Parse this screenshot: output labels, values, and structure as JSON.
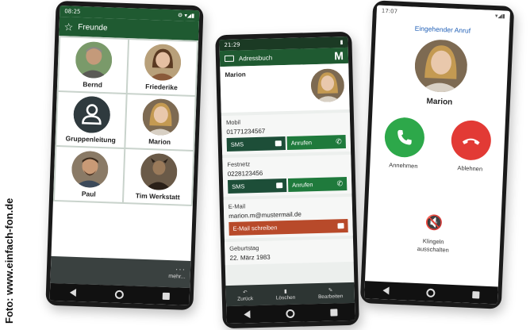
{
  "credit": "Foto: www.einfach-fon.de",
  "phone1": {
    "status_time": "08:25",
    "status_icons": "⚙ ▾◢▮",
    "header_title": "Freunde",
    "contacts": [
      {
        "name": "Bernd",
        "skin": "#c49a7a",
        "bg": "#7a9a6a",
        "hair": "#8a8a85"
      },
      {
        "name": "Friederike",
        "skin": "#e4bfa2",
        "bg": "#b8a07a",
        "hair": "#5a3a22"
      },
      {
        "name": "Gruppenleitung",
        "skin": "",
        "bg": "#2f3a3e",
        "hair": ""
      },
      {
        "name": "Marion",
        "skin": "#e9c8ac",
        "bg": "#7d6a52",
        "hair": "#c49a52"
      },
      {
        "name": "Paul",
        "skin": "#c99a76",
        "bg": "#8a7a66",
        "hair": "#3a2a1c"
      },
      {
        "name": "Tim Werkstatt",
        "skin": "#9a7a5a",
        "bg": "#6a5a48",
        "hair": "#2a2018"
      }
    ],
    "more_label": "mehr..."
  },
  "phone2": {
    "status_time": "21:29",
    "header_title": "Adressbuch",
    "header_letter": "M",
    "contact_name": "Marion",
    "mobile_label": "Mobil",
    "mobile_value": "01771234567",
    "landline_label": "Festnetz",
    "landline_value": "0228123456",
    "sms_label": "SMS",
    "call_label": "Anrufen",
    "email_label": "E-Mail",
    "email_value": "marion.m@mustermail.de",
    "email_button": "E-Mail schreiben",
    "birthday_label": "Geburtstag",
    "birthday_value": "22. März 1983",
    "bottom_back": "Zurück",
    "bottom_delete": "Löschen",
    "bottom_edit": "Bearbeiten"
  },
  "phone3": {
    "status_time": "17:07",
    "status_icons": "▾◢▮",
    "title": "Eingehender Anruf",
    "caller": "Marion",
    "accept_label": "Annehmen",
    "reject_label": "Ablehnen",
    "mute_line1": "Klingeln",
    "mute_line2": "ausschalten"
  },
  "colors": {
    "green_dark": "#1f5a31",
    "accept": "#2da84a",
    "reject": "#e23a35",
    "mail": "#b84a2a",
    "link_blue": "#2563b8"
  }
}
